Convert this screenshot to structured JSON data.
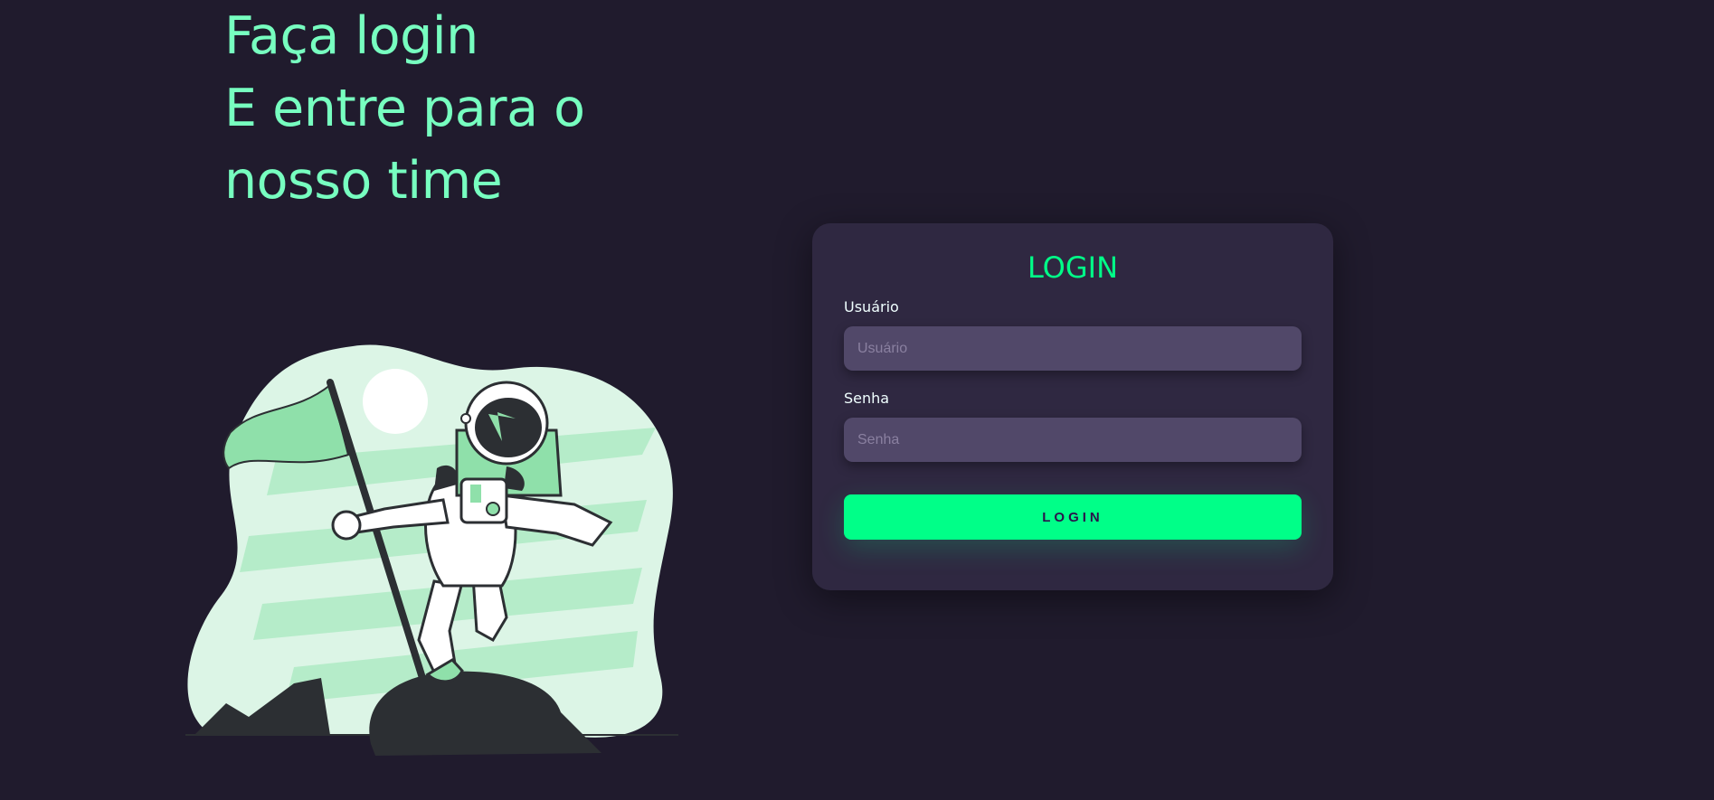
{
  "hero": {
    "line1": "Faça login",
    "line2": "E entre para o",
    "line3": "nosso time"
  },
  "illustration": {
    "name": "astronaut-flag-illustration",
    "colors": {
      "blob": "#dcf5e6",
      "stripes": "#b5ecc9",
      "flag": "#8fe0aa",
      "dark": "#2c2f33",
      "suit": "#ffffff"
    }
  },
  "login_card": {
    "title": "LOGIN",
    "username_label": "Usuário",
    "username_placeholder": "Usuário",
    "username_value": "",
    "password_label": "Senha",
    "password_placeholder": "Senha",
    "password_value": "",
    "submit_label": "LOGIN"
  },
  "colors": {
    "background": "#201b2d",
    "card": "#2f2841",
    "input": "#514869",
    "accent": "#00ff88",
    "headline": "#77ffc0"
  }
}
